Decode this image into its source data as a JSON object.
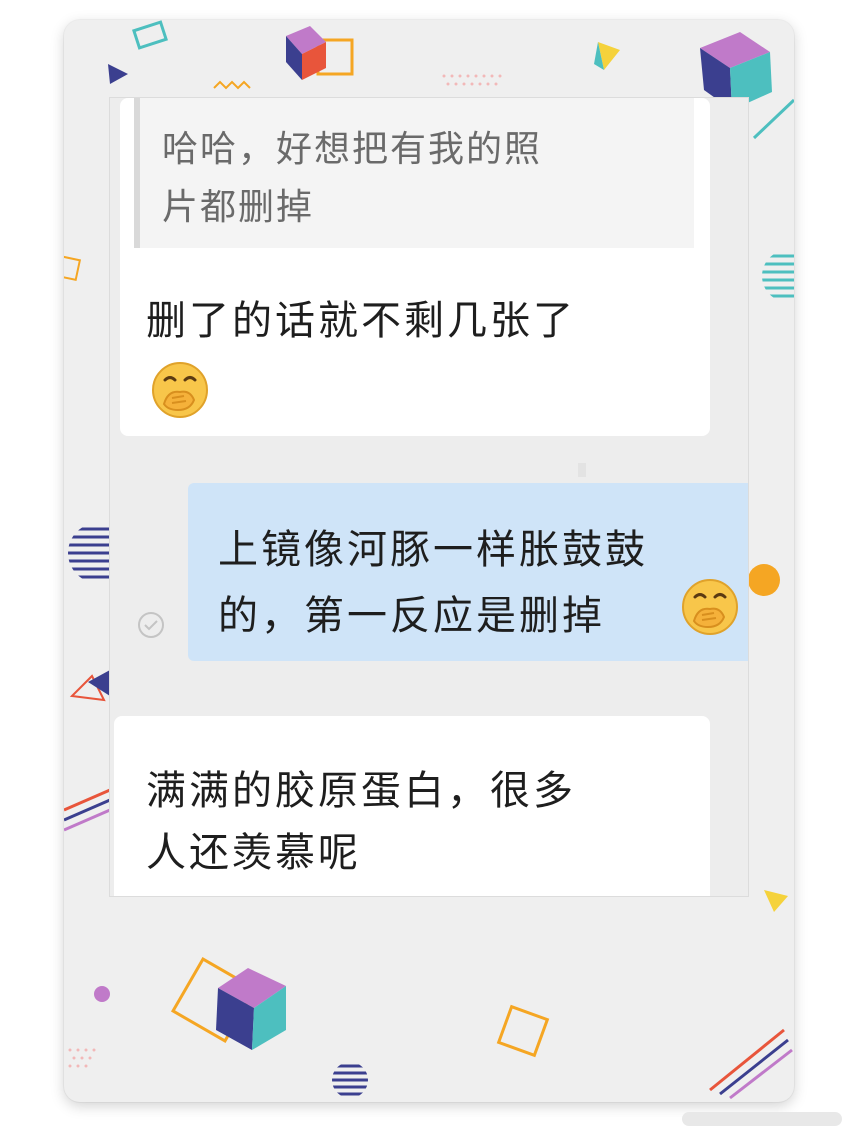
{
  "chat": {
    "quoted_message": {
      "line1": "哈哈，好想把有我的照",
      "line2": "片都删掉"
    },
    "reply1": {
      "line1": "删了的话就不剩几张了",
      "emoji": "covering-mouth-emoji"
    },
    "sent_message": {
      "line1": "上镜像河豚一样胀鼓鼓",
      "line2": "的，第一反应是删掉",
      "emoji": "covering-mouth-emoji",
      "status_icon": "check-circle-icon"
    },
    "reply2": {
      "line1": "满满的胶原蛋白，很多",
      "line2": "人还羡慕呢"
    }
  },
  "colors": {
    "incoming_bubble": "#ffffff",
    "outgoing_bubble": "#cfe4f8",
    "chat_background": "#ededed",
    "frame_background": "#efefef",
    "accent_teal": "#4dbfbf",
    "accent_purple": "#c07ac9",
    "accent_navy": "#3b3f8f",
    "accent_orange": "#f5a623",
    "accent_red": "#e8553b"
  }
}
